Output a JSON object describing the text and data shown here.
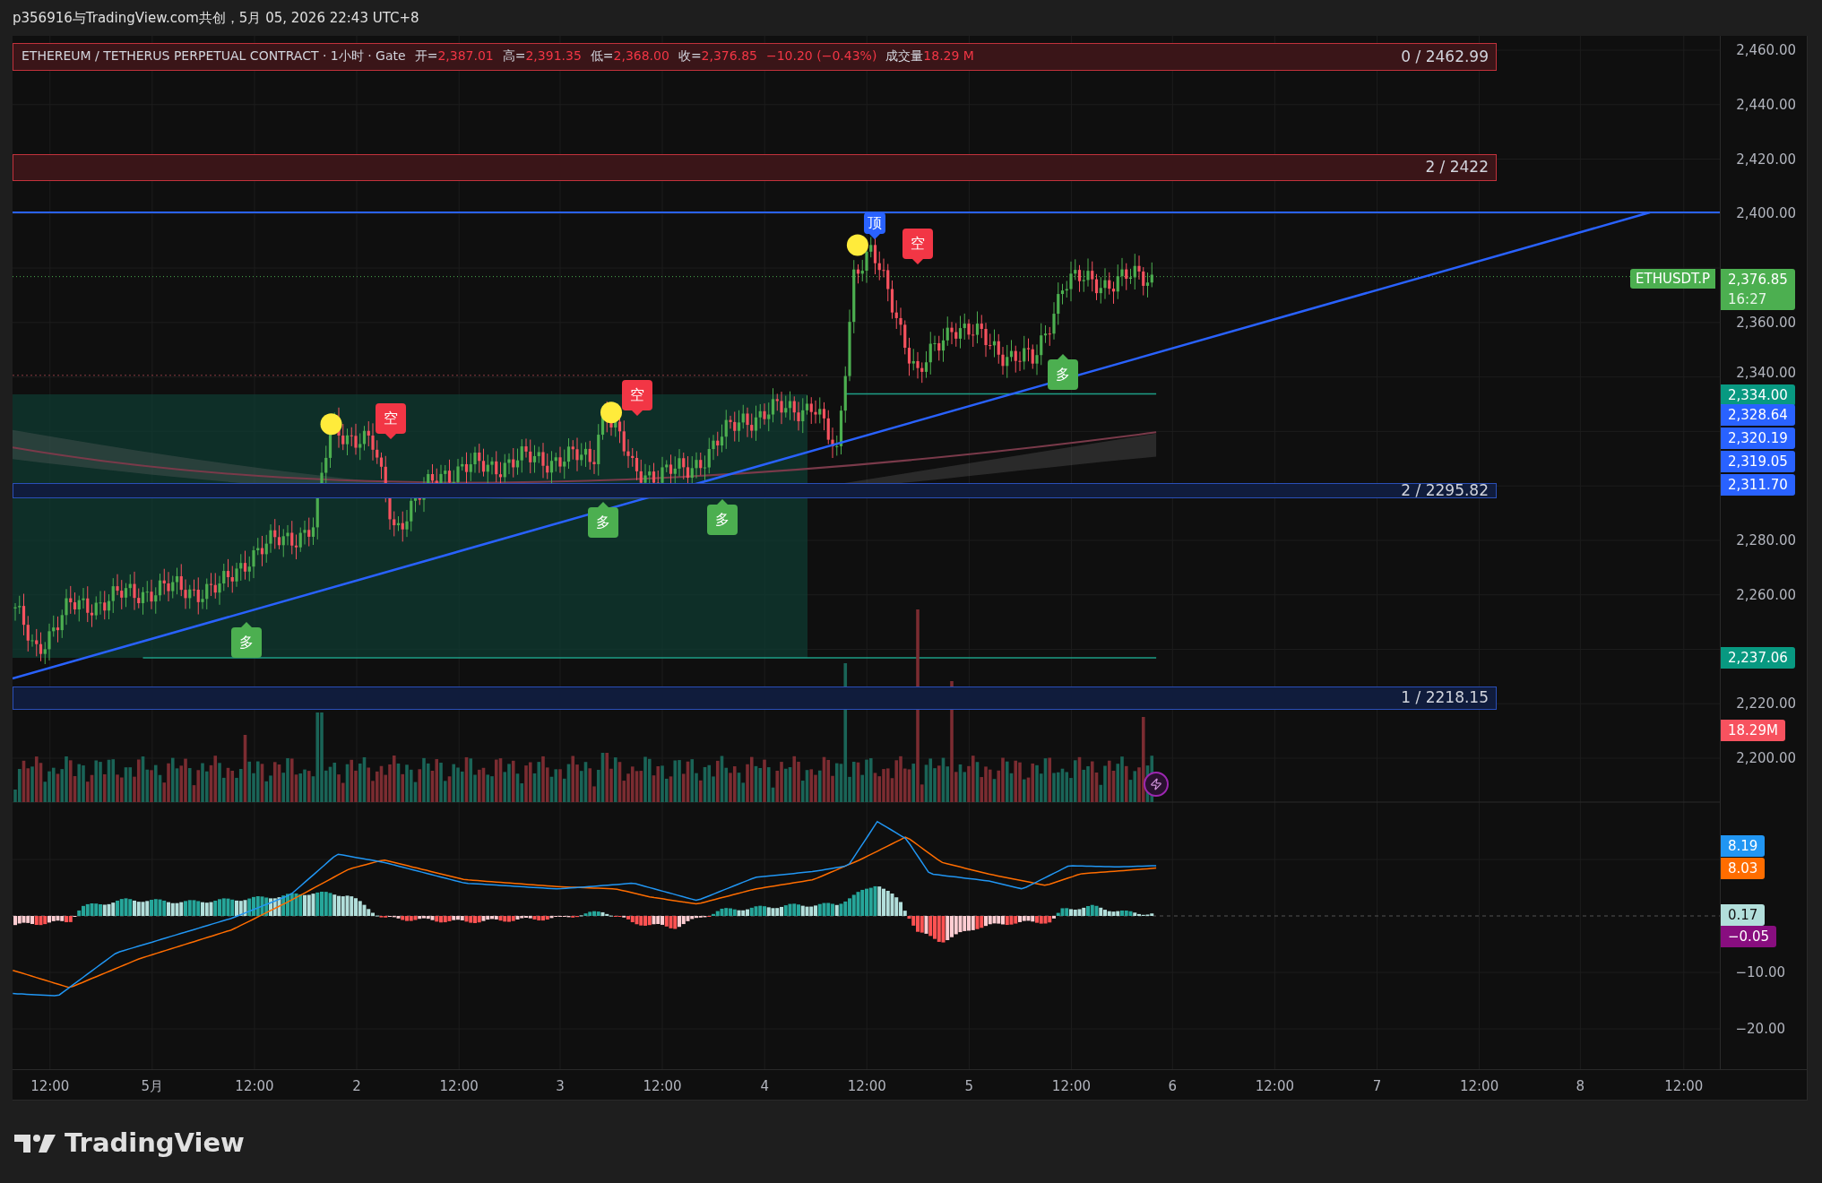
{
  "header": {
    "text": "p356916与TradingView.com共创，5月 05, 2026 22:43 UTC+8"
  },
  "legend": {
    "symbol": "ETHEREUM / TETHERUS PERPETUAL CONTRACT · 1小时 · Gate",
    "fields": [
      {
        "label": "开=",
        "value": "2,387.01"
      },
      {
        "label": "高=",
        "value": "2,391.35"
      },
      {
        "label": "低=",
        "value": "2,368.00"
      },
      {
        "label": "收=",
        "value": "2,376.85"
      }
    ],
    "change": "−10.20 (−0.43%)",
    "volume_label": "成交量",
    "volume": "18.29 M"
  },
  "zones": [
    {
      "kind": "resistance",
      "label": "0 / 2462.99"
    },
    {
      "kind": "resistance",
      "label": "2 / 2422"
    },
    {
      "kind": "support",
      "label": "2 / 2295.82"
    },
    {
      "kind": "support",
      "label": "1 / 2218.15"
    }
  ],
  "signals": [
    {
      "kind": "buy",
      "label": "多"
    },
    {
      "kind": "sell",
      "label": "空"
    },
    {
      "kind": "buy",
      "label": "多"
    },
    {
      "kind": "sell",
      "label": "空"
    },
    {
      "kind": "buy",
      "label": "多"
    },
    {
      "kind": "top",
      "label": "顶"
    },
    {
      "kind": "sell",
      "label": "空"
    },
    {
      "kind": "buy",
      "label": "多"
    }
  ],
  "price_axis": [
    "2,460.00",
    "2,440.00",
    "2,420.00",
    "2,400.00",
    "2,360.00",
    "2,340.00",
    "2,280.00",
    "2,260.00",
    "2,220.00",
    "2,200.00"
  ],
  "symbol_tag": "ETHUSDT.P",
  "price_tags": [
    {
      "text": "2,376.85",
      "sub": "16:27",
      "color": "#4caf50"
    },
    {
      "text": "2,334.00",
      "color": "#089981"
    },
    {
      "text": "2,328.64",
      "color": "#2962ff"
    },
    {
      "text": "2,320.19",
      "color": "#2962ff"
    },
    {
      "text": "2,319.05",
      "color": "#2962ff"
    },
    {
      "text": "2,311.70",
      "color": "#2962ff"
    },
    {
      "text": "2,237.06",
      "color": "#089981"
    },
    {
      "text": "18.29M",
      "color": "#f7525f"
    },
    {
      "text": "8.19",
      "color": "#2196f3"
    },
    {
      "text": "8.03",
      "color": "#ff6d00"
    },
    {
      "text": "0.17",
      "color": "#b2dfdb"
    },
    {
      "text": "−0.05",
      "color": "#880e7f"
    }
  ],
  "oscillator_axis": [
    "−10.00",
    "−20.00"
  ],
  "time_axis": [
    "12:00",
    "5月",
    "12:00",
    "2",
    "12:00",
    "3",
    "12:00",
    "4",
    "12:00",
    "5",
    "12:00",
    "6",
    "12:00",
    "7",
    "12:00",
    "8",
    "12:00"
  ],
  "footer": {
    "brand": "TradingView"
  }
}
